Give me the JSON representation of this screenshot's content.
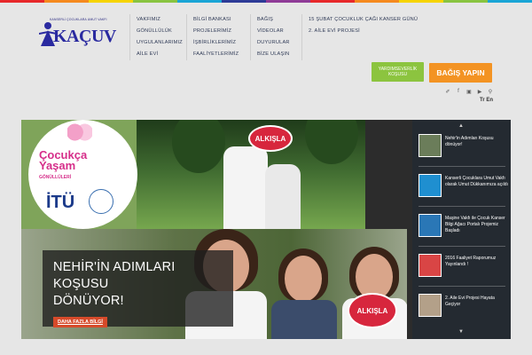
{
  "topstrip_colors": [
    "#e7282b",
    "#f58a1f",
    "#f6d400",
    "#89c441",
    "#1aa5d6",
    "#2d3b97",
    "#8f3b97",
    "#e7282b",
    "#f58a1f",
    "#f6d400",
    "#89c441",
    "#1aa5d6"
  ],
  "brand": {
    "name": "KAÇUV",
    "tagline": "KANSERLİ ÇOCUKLARA UMUT VAKFI",
    "color": "#2a2aa0"
  },
  "nav": {
    "col1": [
      "VAKFIMIZ",
      "GÖNÜLLÜLÜK",
      "UYGULANLARIMIZ",
      "AİLE EVİ"
    ],
    "col2": [
      "BİLGİ BANKASI",
      "PROJELERİMİZ",
      "İŞBİRLİKLERİMİZ",
      "FAALİYETLERİMİZ"
    ],
    "col3": [
      "BAĞIŞ",
      "VİDEOLAR",
      "DUYURULAR",
      "BİZE ULAŞIN"
    ],
    "col4": [
      "15 ŞUBAT ÇOCUKLUK ÇAĞI KANSER GÜNÜ",
      "2. AİLE EVİ PROJESİ"
    ]
  },
  "buttons": {
    "volunteer_line1": "YARDIMSEVERLİK",
    "volunteer_line2": "KOŞUSU",
    "donate": "BAĞIŞ YAPIN",
    "volunteer_color": "#8cc43f",
    "donate_color": "#f39323"
  },
  "social_icons": [
    "twitter-icon",
    "facebook-icon",
    "instagram-icon",
    "youtube-icon",
    "search-icon"
  ],
  "social_glyphs": [
    "✐",
    "f",
    "▣",
    "▶",
    "⚲"
  ],
  "lang": "Tr En",
  "hero": {
    "banner_line1": "Çocukça",
    "banner_line2": "Yaşam",
    "banner_sub": "GÖNÜLLÜLERİ",
    "banner_org": "İTÜ",
    "sign_text": "ALKIŞLA",
    "caption_line1": "NEHİR'İN ADIMLARI KOŞUSU",
    "caption_line2": "DÖNÜYOR!",
    "more_button": "DAHA FAZLA BİLGİ"
  },
  "slider": {
    "items": [
      {
        "text": "Nehir'in Adımları Koşusu dönüyor!",
        "thumb": "#6b7d5a"
      },
      {
        "text": "Kanserli Çocuklara Umut Vakfı olarak Umut Dükkanımıza açıldı",
        "thumb": "#1f8fd0"
      },
      {
        "text": "Maşine Vakfı ile Çocuk Kanser Bilgi Ağacı Portalı Projemiz Başladı",
        "thumb": "#2a77b6"
      },
      {
        "text": "2016 Faaliyet Raporumuz Yayınlandı !",
        "thumb": "#d94545"
      },
      {
        "text": "2. Aile Evi Projesi Hayata Geçiyor",
        "thumb": "#b3a089"
      }
    ]
  }
}
